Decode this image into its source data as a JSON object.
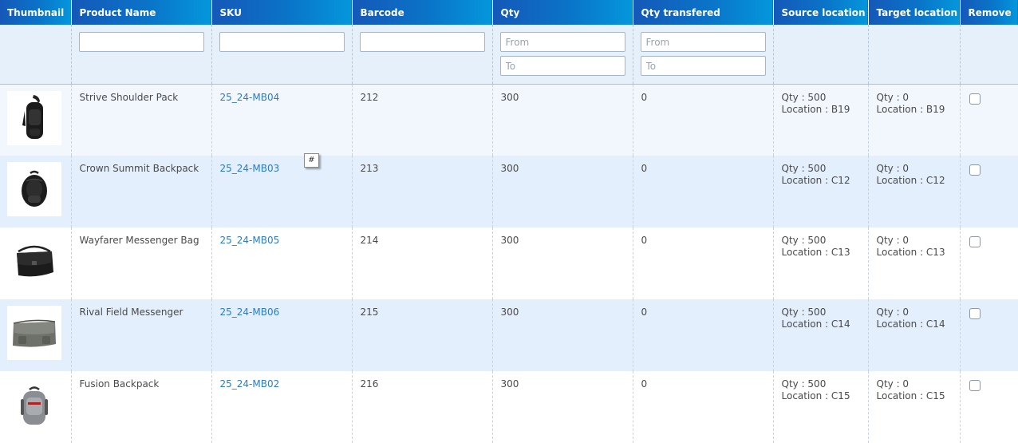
{
  "columns": {
    "thumbnail": "Thumbnail",
    "product_name": "Product Name",
    "sku": "SKU",
    "barcode": "Barcode",
    "qty": "Qty",
    "qty_transfered": "Qty transfered",
    "source_location": "Source location",
    "target_location": "Target location",
    "remove": "Remove"
  },
  "filters": {
    "product_name": {
      "value": "",
      "placeholder": ""
    },
    "sku": {
      "value": "",
      "placeholder": ""
    },
    "barcode": {
      "value": "",
      "placeholder": ""
    },
    "qty_from": {
      "placeholder": "From"
    },
    "qty_to": {
      "placeholder": "To"
    },
    "qty_transfered_from": {
      "placeholder": "From"
    },
    "qty_transfered_to": {
      "placeholder": "To"
    }
  },
  "rows": [
    {
      "name": "Strive Shoulder Pack",
      "sku": "25_24-MB04",
      "barcode": "212",
      "qty": "300",
      "qty_transfered": "0",
      "source_qty": "Qty : 500",
      "source_location": "Location : B19",
      "target_qty": "Qty : 0",
      "target_location": "Location : B19",
      "thumbnail_icon": "shoulder-pack-icon"
    },
    {
      "name": "Crown Summit Backpack",
      "sku": "25_24-MB03",
      "barcode": "213",
      "qty": "300",
      "qty_transfered": "0",
      "source_qty": "Qty : 500",
      "source_location": "Location : C12",
      "target_qty": "Qty : 0",
      "target_location": "Location : C12",
      "thumbnail_icon": "backpack-icon"
    },
    {
      "name": "Wayfarer Messenger Bag",
      "sku": "25_24-MB05",
      "barcode": "214",
      "qty": "300",
      "qty_transfered": "0",
      "source_qty": "Qty : 500",
      "source_location": "Location : C13",
      "target_qty": "Qty : 0",
      "target_location": "Location : C13",
      "thumbnail_icon": "messenger-bag-icon"
    },
    {
      "name": "Rival Field Messenger",
      "sku": "25_24-MB06",
      "barcode": "215",
      "qty": "300",
      "qty_transfered": "0",
      "source_qty": "Qty : 500",
      "source_location": "Location : C14",
      "target_qty": "Qty : 0",
      "target_location": "Location : C14",
      "thumbnail_icon": "field-messenger-icon"
    },
    {
      "name": "Fusion Backpack",
      "sku": "25_24-MB02",
      "barcode": "216",
      "qty": "300",
      "qty_transfered": "0",
      "source_qty": "Qty : 500",
      "source_location": "Location : C15",
      "target_qty": "Qty : 0",
      "target_location": "Location : C15",
      "thumbnail_icon": "fusion-backpack-icon"
    }
  ],
  "tooltip": {
    "text": "#"
  },
  "colors": {
    "header_start": "#1558b8",
    "header_end": "#0497dc",
    "filter_bg": "#e5f0fb",
    "row_light": "#f2f7fd",
    "row_blue": "#e3effc",
    "sku_link": "#2b7bc8"
  }
}
